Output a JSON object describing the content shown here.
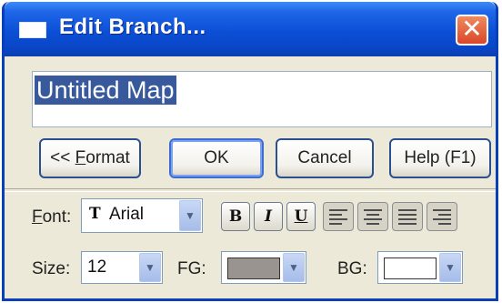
{
  "window": {
    "title": "Edit Branch...",
    "title_icon": "window-icon",
    "close_glyph": "✕"
  },
  "text_area": {
    "value": "Untitled Map"
  },
  "buttons": {
    "format": "<< Format",
    "ok": "OK",
    "cancel": "Cancel",
    "help": "Help (F1)"
  },
  "format_panel": {
    "font_label": "Font:",
    "font_value": "Arial",
    "font_icon": "truetype-font-icon",
    "size_label": "Size:",
    "size_value": "12",
    "fg_label": "FG:",
    "fg_color": "#9a9490",
    "bg_label": "BG:",
    "bg_color": "#ffffff",
    "bold_glyph": "B",
    "italic_glyph": "I",
    "underline_glyph": "U",
    "dropdown_glyph": "▼",
    "alignments": [
      "align-left-icon",
      "align-center-icon",
      "align-justify-icon",
      "align-right-icon"
    ]
  },
  "colors": {
    "titlebar": "#0b4fd6",
    "dialog_bg": "#ece9d8",
    "selection": "#385a9c",
    "close": "#d9472a"
  }
}
